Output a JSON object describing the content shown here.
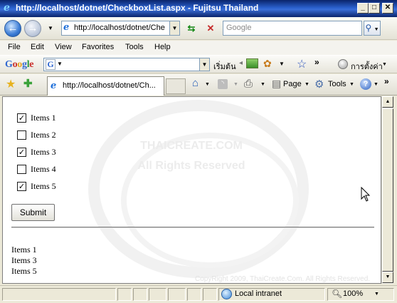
{
  "window": {
    "title": "http://localhost/dotnet/CheckboxList.aspx - Fujitsu Thailand"
  },
  "address_bar": {
    "url": "http://localhost/dotnet/Che",
    "search_placeholder": "Google"
  },
  "menu": {
    "items": [
      "File",
      "Edit",
      "View",
      "Favorites",
      "Tools",
      "Help"
    ]
  },
  "google_toolbar": {
    "logo": "Google",
    "search_label": "เริ่มต้น",
    "settings_label": "การตั้งค่า"
  },
  "tabs": {
    "active_tab_title": "http://localhost/dotnet/Ch...",
    "page_label": "Page",
    "tools_label": "Tools"
  },
  "page": {
    "checkboxes": [
      {
        "label": "Items 1",
        "checked": true
      },
      {
        "label": "Items 2",
        "checked": false
      },
      {
        "label": "Items 3",
        "checked": true
      },
      {
        "label": "Items 4",
        "checked": false
      },
      {
        "label": "Items 5",
        "checked": true
      }
    ],
    "submit_label": "Submit",
    "results": [
      "Items 1",
      "Items 3",
      "Items 5"
    ],
    "watermark_line1": "THAICREATE.COM",
    "watermark_line2": "All Rights Reserved",
    "copyright": "CopyRight 2009, ThaiCreate.Com. All Rights Reserved."
  },
  "status_bar": {
    "zone": "Local intranet",
    "zoom": "100%"
  }
}
